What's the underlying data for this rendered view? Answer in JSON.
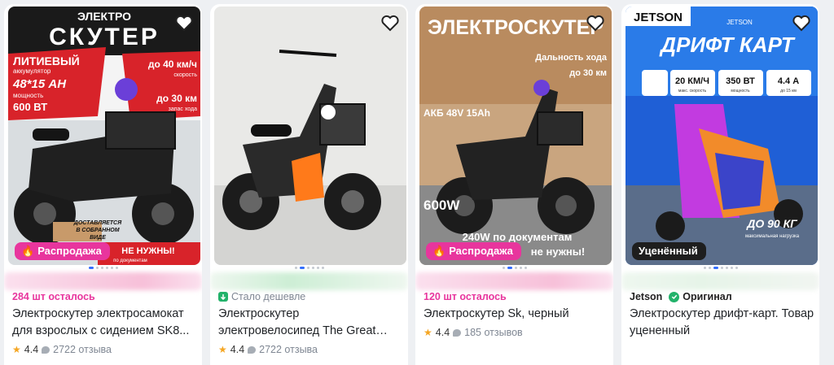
{
  "products": [
    {
      "badge": "Распродажа",
      "stock": "284 шт осталось",
      "title": "Электроскутер электросамокат для взрослых с сидением SK8...",
      "rating": "4.4",
      "reviews": "2722 отзыва",
      "banner": {
        "top": "ЭЛЕКТРО",
        "main": "СКУТЕР",
        "battery": "ЛИТИЕВЫЙ",
        "battery_sub": "аккумулятор",
        "battery_spec": "48*15 АН",
        "power_label": "мощность",
        "power": "600 ВТ",
        "speed": "до 40 км/ч",
        "speed_label": "скорость",
        "range": "до 30 км",
        "range_label": "запас хода",
        "note1": "ДОСТАВЛЯЕТСЯ",
        "note2": "В СОБРАННОМ",
        "note3": "ВИДЕ",
        "note4": "НЕ НУЖНЫ!",
        "note5": "по документам"
      }
    },
    {
      "price_drop": "Стало дешевле",
      "title": "Электроскутер электровелосипед The Great Pa...",
      "rating": "4.4",
      "reviews": "2722 отзыва"
    },
    {
      "badge": "Распродажа",
      "stock": "120 шт осталось",
      "title": "Электроскутер Sk, черный",
      "rating": "4.4",
      "reviews": "185 отзывов",
      "banner": {
        "main": "ЭЛЕКТРОСКУТЕР",
        "range_label": "Дальность хода",
        "range": "до 30 км",
        "battery": "АКБ 48V 15Ah",
        "power": "600W",
        "doc_power": "240W по документам",
        "doc_note": "не нужны!"
      }
    },
    {
      "badge": "Уценённый",
      "brand": "Jetson",
      "original": "Оригинал",
      "title": "Электроскутер дрифт-карт. Товар уцененный",
      "banner": {
        "logo": "JETSON",
        "small_logo": "JETSON",
        "main": "ДРИФТ КАРТ",
        "speed": "20 КМ/Ч",
        "speed_label": "макс. скорость",
        "power": "350 ВТ",
        "power_label": "мощность",
        "current": "4.4 А",
        "current_label": "до 15 км",
        "load": "ДО 90 КГ",
        "load_label": "максимальная нагрузка"
      }
    }
  ],
  "colors": {
    "sale": "#e8359d",
    "accent": "#1d62f0",
    "star": "#f5a623",
    "green": "#22b26a"
  }
}
